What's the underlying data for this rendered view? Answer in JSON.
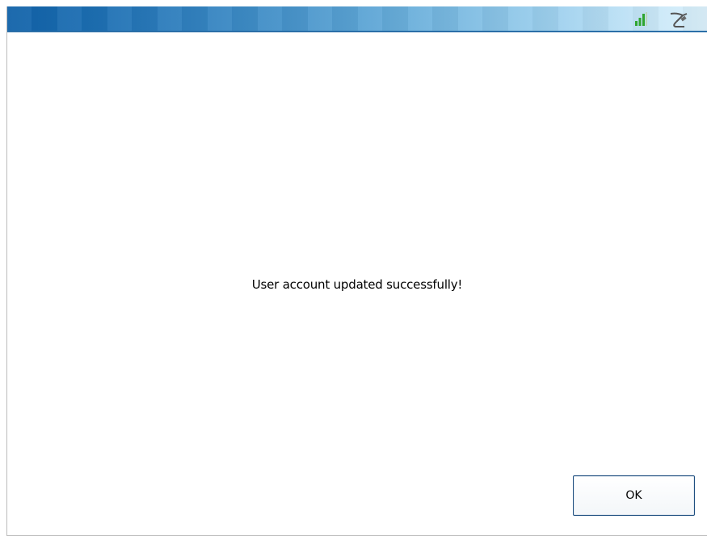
{
  "status_bar": {
    "icons": [
      {
        "name": "signal-strength-icon",
        "color": "#2fa52f"
      },
      {
        "name": "connection-plug-icon",
        "color": "#555555"
      }
    ],
    "gradient_start": "#1162a9",
    "gradient_end": "#dbf0fb"
  },
  "dialog": {
    "message": "User account updated successfully!",
    "ok_label": "OK"
  }
}
